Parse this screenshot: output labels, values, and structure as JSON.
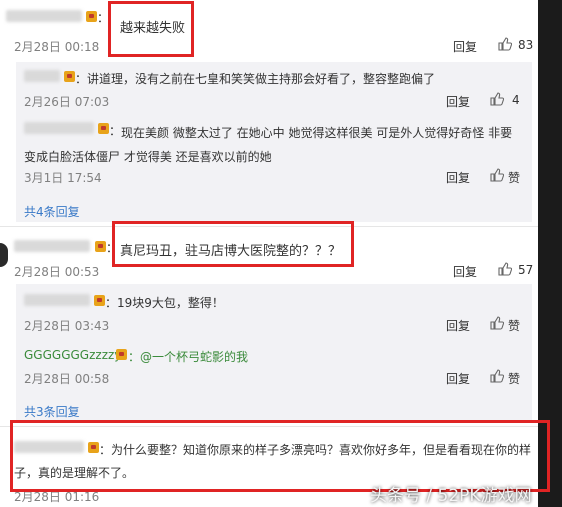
{
  "comments": [
    {
      "name_suffix": "：",
      "text": "越来越失败",
      "time": "2月28日 00:18",
      "reply_label": "回复",
      "like_count": "83",
      "replies": [
        {
          "name_suffix": "：",
          "text": "讲道理，没有之前在七皇和笑笑做主持那会好看了，整容整跑偏了",
          "time": "2月26日 07:03",
          "reply_label": "回复",
          "like_count": "4"
        },
        {
          "name_suffix": "：",
          "text_line1": "现在美颜 微整太过了  在她心中 她觉得这样很美  可是外人觉得好奇怪   非要",
          "text_line2": "变成白脸活体僵尸 才觉得美  还是喜欢以前的她",
          "time": "3月1日 17:54",
          "reply_label": "回复",
          "like_label": "赞"
        }
      ],
      "more_replies": "共4条回复"
    },
    {
      "name_suffix": "：",
      "text": "真尼玛丑，驻马店博大医院整的？？？",
      "time": "2月28日 00:53",
      "reply_label": "回复",
      "like_count": "57",
      "replies": [
        {
          "name_suffix": "：",
          "text": "19块9大包，整得！",
          "time": "2月28日 03:43",
          "reply_label": "回复",
          "like_label": "赞"
        },
        {
          "name": "GGGGGGGzzzzy",
          "text": "：@一个杯弓蛇影的我",
          "time": "2月28日 00:58",
          "reply_label": "回复",
          "like_label": "赞"
        }
      ],
      "more_replies": "共3条回复"
    },
    {
      "name_suffix": "：",
      "text_line1": "为什么要整？知道你原来的样子多漂亮吗？喜欢你好多年，但是看看现在你的样",
      "text_line2": "子，真的是理解不了。",
      "time": "2月28日 01:16"
    }
  ],
  "watermark": "头条号 / 52PK游戏网",
  "colors": {
    "highlight_box": "#e02424",
    "link": "#3a7ac8",
    "subpanel": "#f2f2f5",
    "badge": "#e8a31a"
  }
}
